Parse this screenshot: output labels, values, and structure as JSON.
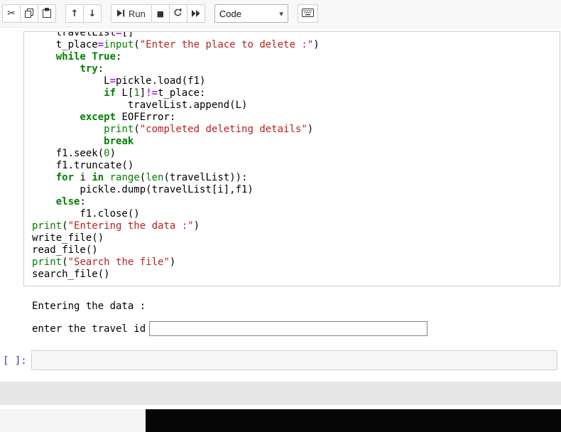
{
  "toolbar": {
    "run_label": "Run",
    "cell_type_value": "Code",
    "glyphs": {
      "cut": "✂",
      "up": "↑",
      "down": "↓",
      "stop": "■",
      "select_arrow": "▾"
    }
  },
  "code_cell": {
    "lines": [
      [
        {
          "t": "    travelList",
          "c": "v"
        },
        {
          "t": "=",
          "c": "o"
        },
        {
          "t": "[]",
          "c": "v"
        }
      ],
      [
        {
          "t": "    t_place",
          "c": "v"
        },
        {
          "t": "=",
          "c": "o"
        },
        {
          "t": "input",
          "c": "b"
        },
        {
          "t": "(",
          "c": "v"
        },
        {
          "t": "\"Enter the place to delete :\"",
          "c": "s"
        },
        {
          "t": ")",
          "c": "v"
        }
      ],
      [
        {
          "t": "    ",
          "c": "v"
        },
        {
          "t": "while",
          "c": "k"
        },
        {
          "t": " ",
          "c": "v"
        },
        {
          "t": "True",
          "c": "k"
        },
        {
          "t": ":",
          "c": "v"
        }
      ],
      [
        {
          "t": "        ",
          "c": "v"
        },
        {
          "t": "try",
          "c": "k"
        },
        {
          "t": ":",
          "c": "v"
        }
      ],
      [
        {
          "t": "            L",
          "c": "v"
        },
        {
          "t": "=",
          "c": "o"
        },
        {
          "t": "pickle.load(f1)",
          "c": "v"
        }
      ],
      [
        {
          "t": "            ",
          "c": "v"
        },
        {
          "t": "if",
          "c": "k"
        },
        {
          "t": " L[",
          "c": "v"
        },
        {
          "t": "1",
          "c": "n"
        },
        {
          "t": "]",
          "c": "v"
        },
        {
          "t": "!=",
          "c": "o"
        },
        {
          "t": "t_place:",
          "c": "v"
        }
      ],
      [
        {
          "t": "                travelList.append(L)",
          "c": "v"
        }
      ],
      [
        {
          "t": "        ",
          "c": "v"
        },
        {
          "t": "except",
          "c": "k"
        },
        {
          "t": " EOFError:",
          "c": "v"
        }
      ],
      [
        {
          "t": "            ",
          "c": "v"
        },
        {
          "t": "print",
          "c": "b"
        },
        {
          "t": "(",
          "c": "v"
        },
        {
          "t": "\"completed deleting details\"",
          "c": "s"
        },
        {
          "t": ")",
          "c": "v"
        }
      ],
      [
        {
          "t": "            ",
          "c": "v"
        },
        {
          "t": "break",
          "c": "k"
        }
      ],
      [
        {
          "t": "    f1.seek(",
          "c": "v"
        },
        {
          "t": "0",
          "c": "n"
        },
        {
          "t": ")",
          "c": "v"
        }
      ],
      [
        {
          "t": "    f1.truncate()",
          "c": "v"
        }
      ],
      [
        {
          "t": "    ",
          "c": "v"
        },
        {
          "t": "for",
          "c": "k"
        },
        {
          "t": " i ",
          "c": "v"
        },
        {
          "t": "in",
          "c": "k"
        },
        {
          "t": " ",
          "c": "v"
        },
        {
          "t": "range",
          "c": "b"
        },
        {
          "t": "(",
          "c": "v"
        },
        {
          "t": "len",
          "c": "b"
        },
        {
          "t": "(travelList)):",
          "c": "v"
        }
      ],
      [
        {
          "t": "        pickle.dump(travelList[i],f1)",
          "c": "v"
        }
      ],
      [
        {
          "t": "    ",
          "c": "v"
        },
        {
          "t": "else",
          "c": "k"
        },
        {
          "t": ":",
          "c": "v"
        }
      ],
      [
        {
          "t": "        f1.close()",
          "c": "v"
        }
      ],
      [
        {
          "t": "print",
          "c": "b"
        },
        {
          "t": "(",
          "c": "v"
        },
        {
          "t": "\"Entering the data :\"",
          "c": "s"
        },
        {
          "t": ")",
          "c": "v"
        }
      ],
      [
        {
          "t": "write_file()",
          "c": "v"
        }
      ],
      [
        {
          "t": "read_file()",
          "c": "v"
        }
      ],
      [
        {
          "t": "print",
          "c": "b"
        },
        {
          "t": "(",
          "c": "v"
        },
        {
          "t": "\"Search the file\"",
          "c": "s"
        },
        {
          "t": ")",
          "c": "v"
        }
      ],
      [
        {
          "t": "search_file()",
          "c": "v"
        }
      ]
    ]
  },
  "output": {
    "stdout": "Entering the data :",
    "stdin_prompt": "enter the travel id",
    "stdin_value": ""
  },
  "empty_cell": {
    "prompt": "[ ]:"
  },
  "colors": {
    "keyword": "#008000",
    "builtin": "#008000",
    "string": "#BA2121",
    "operator": "#AA22FF",
    "number": "#008800",
    "cell_border": "#cfcfcf",
    "prompt": "#303F9F"
  }
}
